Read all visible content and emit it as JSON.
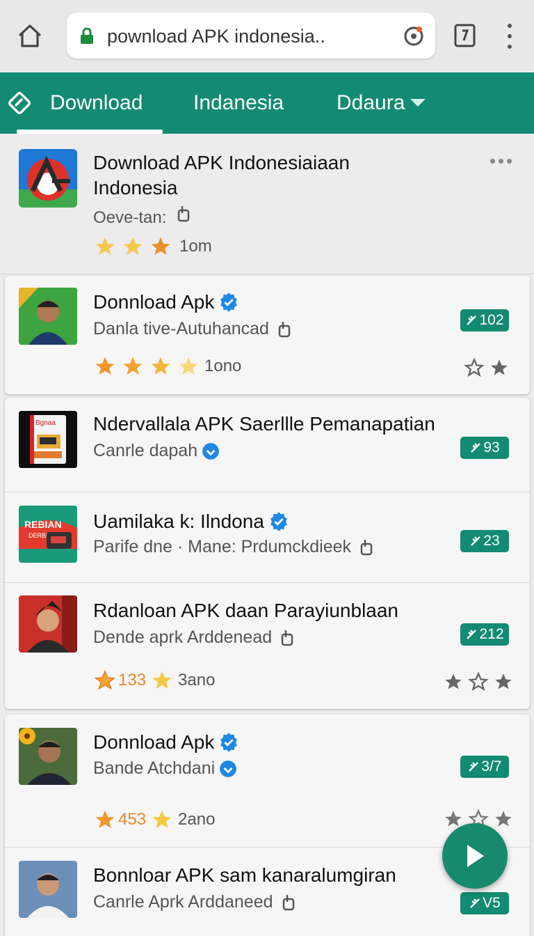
{
  "browser": {
    "url": "pownload APK indonesia..",
    "icons": [
      "home-icon",
      "lock-icon",
      "refresh-icon",
      "tabs-icon",
      "menu-icon"
    ]
  },
  "nav": {
    "tabs": [
      "Download",
      "Indanesia",
      "Ddaura"
    ],
    "accent": "#138a72"
  },
  "featured": {
    "title": "Download APK Indonesiaiaan Indonesia",
    "subtitle": "Oeve-tan:",
    "rating_text": "1om"
  },
  "apps": [
    {
      "title": "Donnload Apk",
      "subtitle": "Danla tive-Autuhancad",
      "badge": "102",
      "rating_text": "1ono"
    },
    {
      "title": "Ndervallala APK Saerllle Pemanapatian",
      "subtitle": "Canrle dapah",
      "badge": "93"
    },
    {
      "title": "Uamilaka k: Ilndona",
      "subtitle": "Parife dne · Mane: Prdumckdieek",
      "badge": "23"
    },
    {
      "title": "Rdanloan APK daan Parayiunblaan",
      "subtitle": "Dende aprk Arddenead",
      "badge": "212",
      "rating_count": "133",
      "rating_text": "3ano"
    },
    {
      "title": "Donnload Apk",
      "subtitle": "Bande Atchdani",
      "badge": "3/7",
      "rating_count": "453",
      "rating_text": "2ano"
    },
    {
      "title": "Bonnloar APK sam kanaralumgiran",
      "subtitle": "Canrle Aprk Arddaneed",
      "badge": "V5"
    }
  ],
  "colors": {
    "star": "#f2a535",
    "star_light": "#f7d77a",
    "verified": "#1e88e5",
    "badge": "#138a72"
  }
}
